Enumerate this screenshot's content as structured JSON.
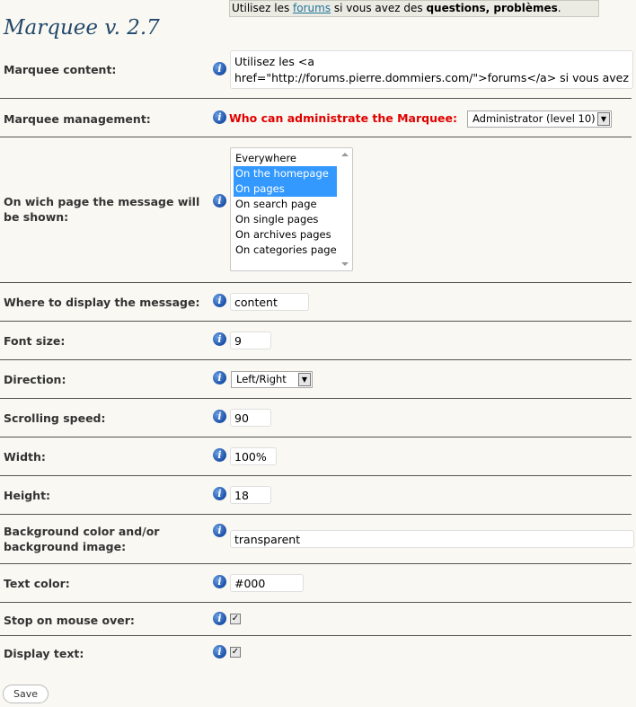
{
  "preview": {
    "prefix": "Utilisez les ",
    "link": "forums",
    "middle": " si vous avez des ",
    "bold": "questions, problèmes",
    "suffix": "."
  },
  "title": "Marquee v. 2.7",
  "fields": {
    "content": {
      "label": "Marquee content:",
      "value": "Utilisez les <a href=\"http://forums.pierre.dommiers.com/\">forums</a> si vous avez des <b>questions, problèmes</b>."
    },
    "management": {
      "label": "Marquee management:",
      "who_label": "Who can administrate the Marquee:",
      "selected": "Administrator (level 10)"
    },
    "pages": {
      "label": "On wich page the message will be shown:",
      "options": [
        "Everywhere",
        "On the homepage",
        "On pages",
        "On search page",
        "On single pages",
        "On archives pages",
        "On categories page"
      ],
      "selected": [
        "On the homepage",
        "On pages"
      ]
    },
    "where": {
      "label": "Where to display the message:",
      "value": "content"
    },
    "font_size": {
      "label": "Font size:",
      "value": "9"
    },
    "direction": {
      "label": "Direction:",
      "selected": "Left/Right"
    },
    "speed": {
      "label": "Scrolling speed:",
      "value": "90"
    },
    "width": {
      "label": "Width:",
      "value": "100%"
    },
    "height": {
      "label": "Height:",
      "value": "18"
    },
    "background": {
      "label": "Background color and/or background image:",
      "value": "transparent"
    },
    "text_color": {
      "label": "Text color:",
      "value": "#000"
    },
    "stop_hover": {
      "label": "Stop on mouse over:",
      "checked": true
    },
    "display_text": {
      "label": "Display text:",
      "checked": true
    }
  },
  "save_label": "Save",
  "icons": {
    "info": "info-icon",
    "check": "✓",
    "arrow": "▼"
  },
  "colors": {
    "background": "#f9f8f2",
    "title": "#23486a",
    "alert": "#e00000",
    "selection": "#3399ff",
    "link": "#21759b"
  }
}
